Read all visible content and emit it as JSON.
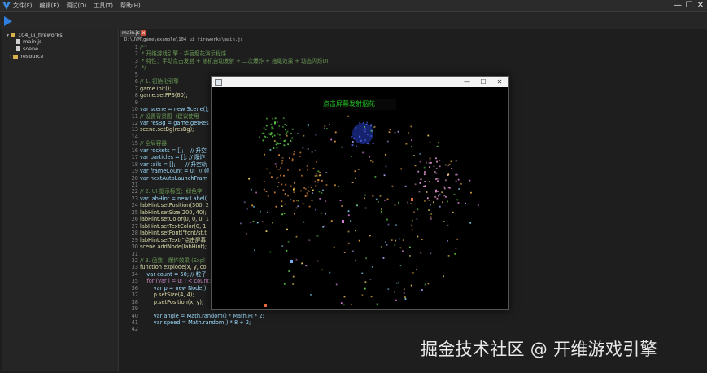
{
  "app": {
    "menu": [
      "文件(F)",
      "编辑(E)",
      "调试(D)",
      "工具(T)",
      "帮助(H)"
    ],
    "window_controls": [
      "—",
      "☐",
      "✕"
    ]
  },
  "sidebar": {
    "project": "104_ui_fireworks",
    "items": [
      "main.js",
      "scene",
      "resource"
    ]
  },
  "editor": {
    "tab_label": "main.js",
    "tab_close": "x",
    "path": "D:\\UVM\\game\\example\\104_ui_fireworks\\main.js",
    "lines": [
      {
        "n": "1",
        "text": "/**",
        "color": "#6a9955"
      },
      {
        "n": "2",
        "text": " * 开维游戏引擎 - 华丽烟花演示程序",
        "color": "#6a9955"
      },
      {
        "n": "3",
        "text": " * 特性：手动点击发射 + 随机自动发射 + 二次爆炸 + 拖尾效果 + 动态闪烁UI",
        "color": "#6a9955"
      },
      {
        "n": "4",
        "text": " */",
        "color": "#6a9955"
      },
      {
        "n": "5",
        "text": "",
        "color": "#d4d4d4"
      },
      {
        "n": "6",
        "text": "// 1. 初始化引擎",
        "color": "#6a9955"
      },
      {
        "n": "7",
        "text": "game.init();",
        "color": "#dcdcaa"
      },
      {
        "n": "8",
        "text": "game.setFPS(60);",
        "color": "#dcdcaa"
      },
      {
        "n": "9",
        "text": "",
        "color": "#d4d4d4"
      },
      {
        "n": "10",
        "text": "var scene = new Scene();",
        "color": "#9cdcfe"
      },
      {
        "n": "11",
        "text": "// 设置背景图（建议使用一",
        "color": "#6a9955"
      },
      {
        "n": "12",
        "text": "var resBg = game.getRes",
        "color": "#9cdcfe"
      },
      {
        "n": "13",
        "text": "scene.setBg(resBg);",
        "color": "#dcdcaa"
      },
      {
        "n": "14",
        "text": "",
        "color": "#d4d4d4"
      },
      {
        "n": "15",
        "text": "// 全局容器",
        "color": "#6a9955"
      },
      {
        "n": "16",
        "text": "var rockets = [];    // 升空",
        "color": "#9cdcfe"
      },
      {
        "n": "17",
        "text": "var particles = []; // 爆炸",
        "color": "#9cdcfe"
      },
      {
        "n": "18",
        "text": "var tails = [];      // 升空轨",
        "color": "#9cdcfe"
      },
      {
        "n": "19",
        "text": "var frameCount = 0;  // 帧",
        "color": "#9cdcfe"
      },
      {
        "n": "20",
        "text": "var nextAutoLaunchFram",
        "color": "#9cdcfe"
      },
      {
        "n": "21",
        "text": "",
        "color": "#d4d4d4"
      },
      {
        "n": "22",
        "text": "// 2. UI 提示标签：绿色字",
        "color": "#6a9955"
      },
      {
        "n": "23",
        "text": "var labHint = new Label(",
        "color": "#9cdcfe"
      },
      {
        "n": "24",
        "text": "labHint.setPosition(300, 2",
        "color": "#dcdcaa"
      },
      {
        "n": "25",
        "text": "labHint.setSize(200, 40);",
        "color": "#dcdcaa"
      },
      {
        "n": "26",
        "text": "labHint.setColor(0, 0, 0, 1",
        "color": "#dcdcaa"
      },
      {
        "n": "27",
        "text": "labHint.setTextColor(0, 1,",
        "color": "#dcdcaa"
      },
      {
        "n": "28",
        "text": "labHint.setFont(\"font/st.t",
        "color": "#dcdcaa"
      },
      {
        "n": "29",
        "text": "labHint.setText(\"点击屏幕",
        "color": "#dcdcaa"
      },
      {
        "n": "30",
        "text": "scene.addNode(labHint);",
        "color": "#dcdcaa"
      },
      {
        "n": "31",
        "text": "",
        "color": "#d4d4d4"
      },
      {
        "n": "32",
        "text": "// 3. 函数：爆炸效果 (Expl",
        "color": "#6a9955"
      },
      {
        "n": "33",
        "text": "function explode(x, y, col",
        "color": "#dcdcaa"
      },
      {
        "n": "34",
        "text": "    var count = 50; // 粒子",
        "color": "#9cdcfe"
      },
      {
        "n": "35",
        "text": "    for (var i = 0; i < count; i++) {",
        "color": "#c586c0"
      },
      {
        "n": "36",
        "text": "        var p = new Node();",
        "color": "#9cdcfe"
      },
      {
        "n": "37",
        "text": "        p.setSize(4, 4);",
        "color": "#dcdcaa"
      },
      {
        "n": "38",
        "text": "        p.setPosition(x, y);",
        "color": "#dcdcaa"
      },
      {
        "n": "39",
        "text": "",
        "color": "#d4d4d4"
      },
      {
        "n": "40",
        "text": "        var angle = Math.random() * Math.PI * 2;",
        "color": "#9cdcfe"
      },
      {
        "n": "41",
        "text": "        var speed = Math.random() * 8 + 2;",
        "color": "#9cdcfe"
      },
      {
        "n": "42",
        "text": "",
        "color": "#d4d4d4"
      }
    ]
  },
  "run_window": {
    "controls": [
      "—",
      "☐",
      "✕"
    ],
    "hint_text": "点击屏幕发射烟花"
  },
  "watermark": "掘金技术社区 @ 开维游戏引擎"
}
